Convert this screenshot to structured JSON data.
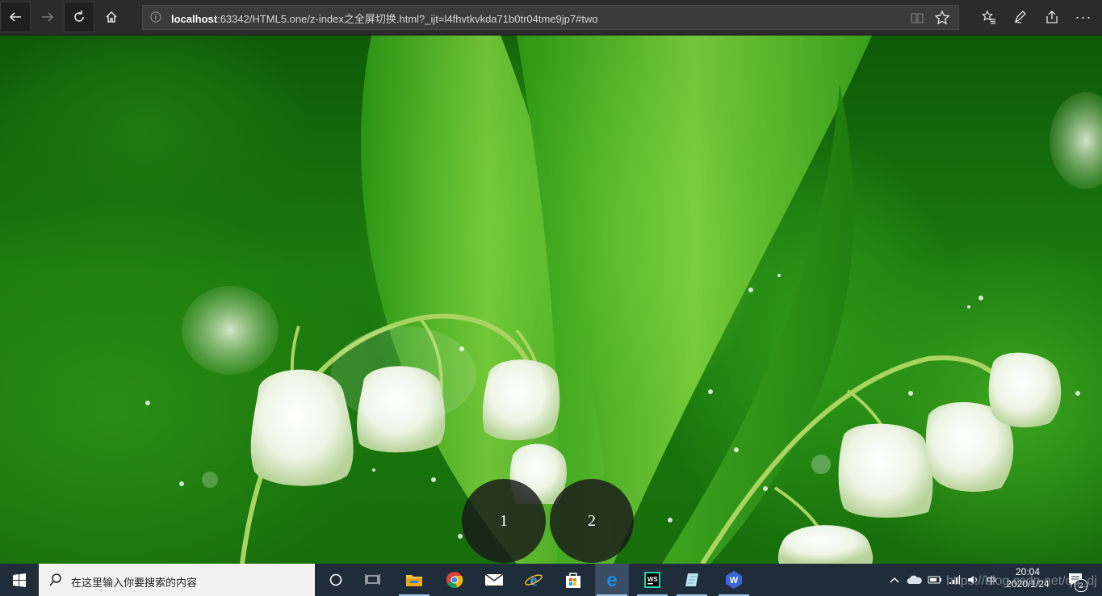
{
  "browser": {
    "url_host": "localhost",
    "url_rest": ":63342/HTML5.one/z-index之全屏切换.html?_ijt=l4fhvtkvkda71b0tr04tme9jp7#two",
    "buttons": {
      "back": "back-arrow-icon",
      "forward": "forward-arrow-icon",
      "refresh": "refresh-icon",
      "home": "home-icon",
      "reading_view": "reading-view-icon",
      "favorite": "star-icon",
      "favorites_hub": "favorites-list-icon",
      "notes": "pen-icon",
      "share": "share-icon",
      "more": "more-icon"
    },
    "more_label": "···"
  },
  "page": {
    "pager": [
      {
        "label": "1"
      },
      {
        "label": "2"
      }
    ]
  },
  "taskbar": {
    "search_placeholder": "在这里输入你要搜索的内容",
    "apps": [
      "cortana-circle-icon",
      "task-view-icon",
      "file-explorer-icon",
      "chrome-icon",
      "mail-icon",
      "internet-explorer-icon",
      "store-icon",
      "edge-icon",
      "webstorm-icon",
      "notes-app-icon",
      "wps-icon"
    ],
    "tray": {
      "ime": "中",
      "time": "20:04",
      "date": "2020/1/24",
      "notification_count": "2"
    },
    "watermark": "https://blog.csdn.net/qq_dj"
  },
  "colors": {
    "toolbar_bg": "#2b2b2b",
    "taskbar_bg": "#1f2c3a",
    "pager_bg": "#191919"
  }
}
